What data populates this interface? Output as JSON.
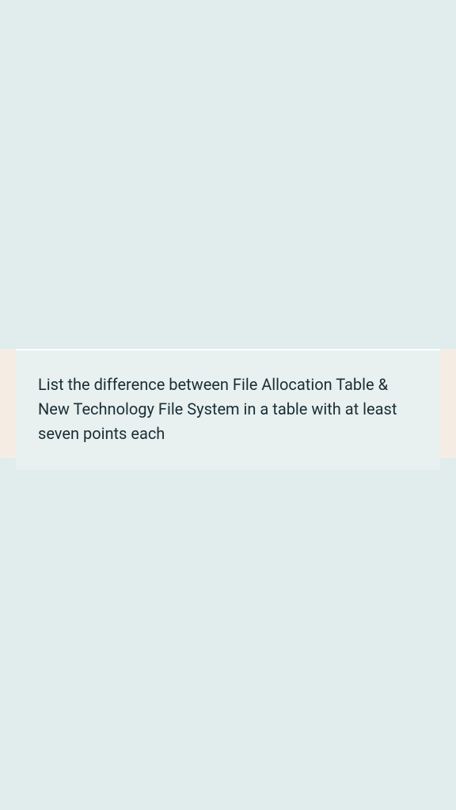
{
  "message": {
    "text": "List the difference between File Allocation Table & New Technology File System in a table with at least seven points each"
  }
}
